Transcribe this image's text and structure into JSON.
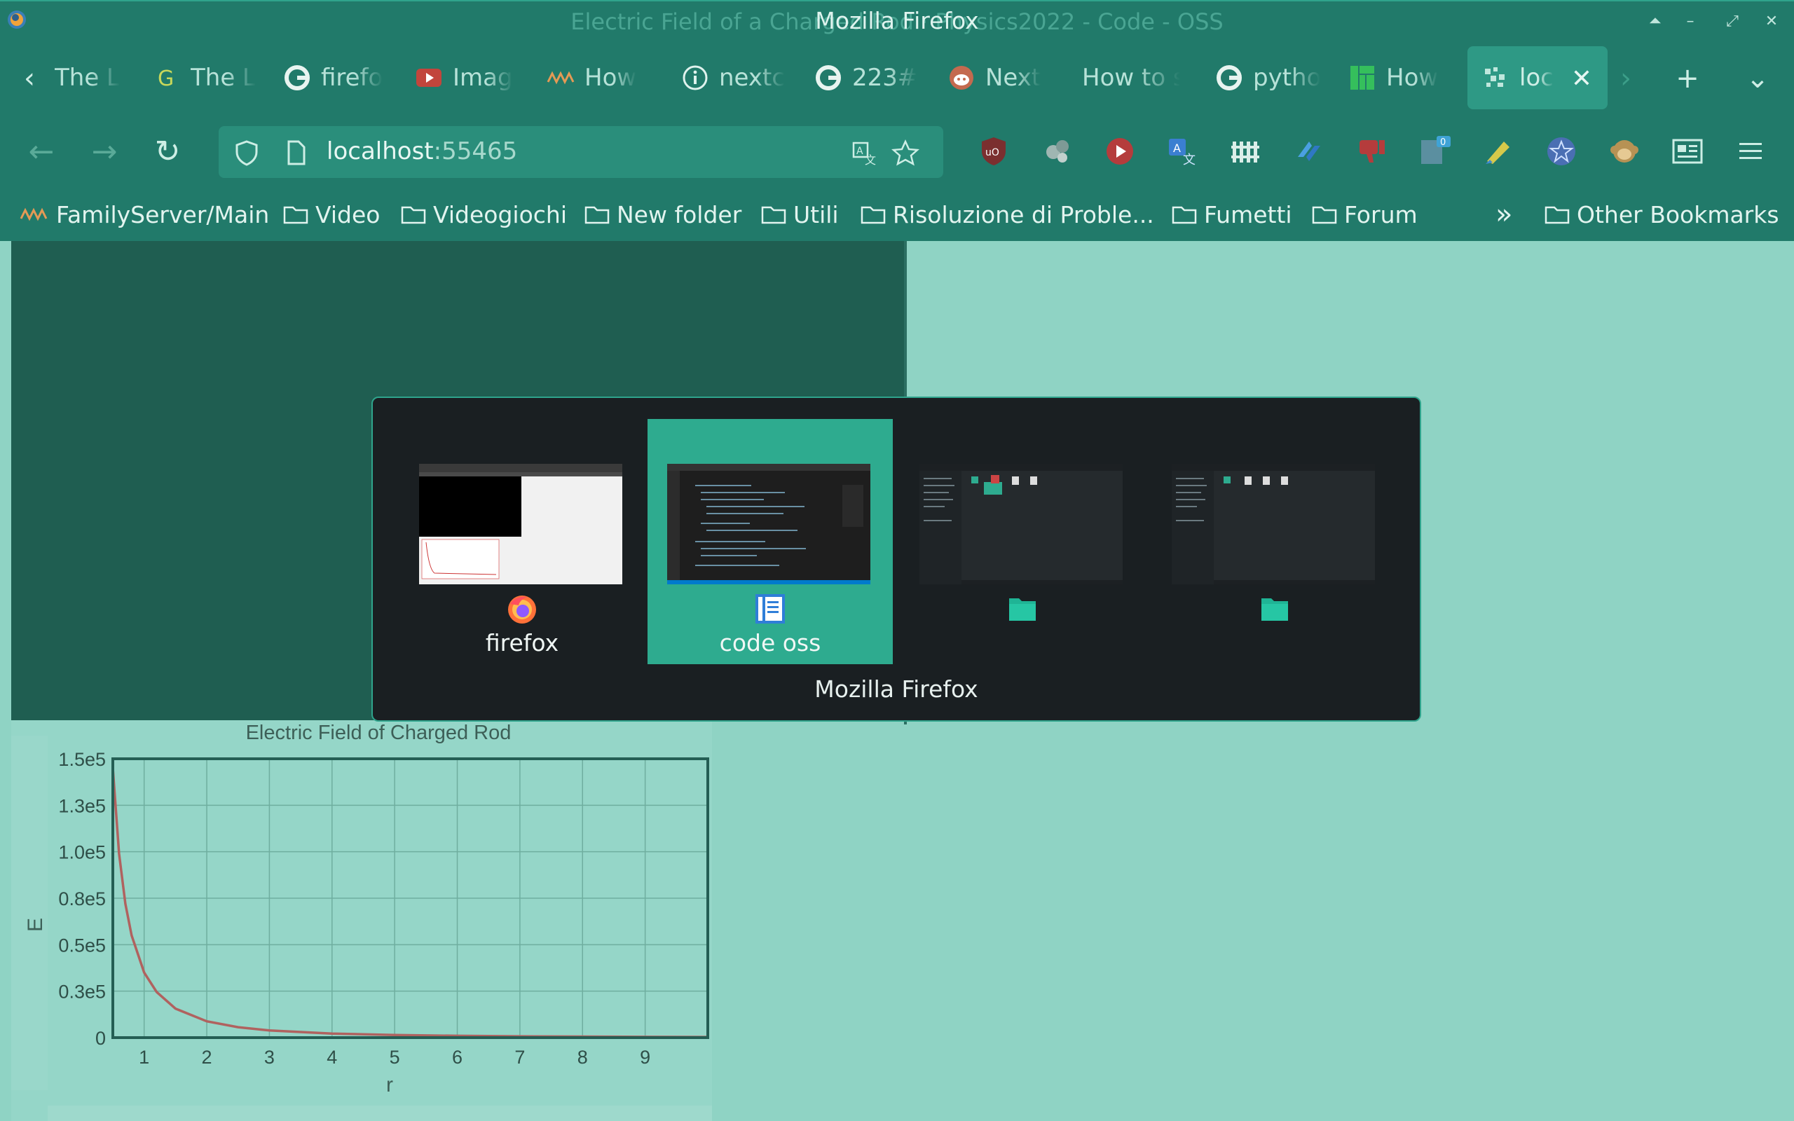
{
  "window": {
    "title_ghost": "Electric Field of a Charged Rod · Physics2022 - Code - OSS",
    "title": "Mozilla Firefox"
  },
  "tabs": [
    {
      "label": "The L",
      "icon": "back-icon"
    },
    {
      "label": "The L",
      "icon": "g-icon"
    },
    {
      "label": "firefo",
      "icon": "google-icon"
    },
    {
      "label": "Imag",
      "icon": "youtube-icon"
    },
    {
      "label": "How",
      "icon": "nextcloud-icon"
    },
    {
      "label": "nextc",
      "icon": "info-icon"
    },
    {
      "label": "223#",
      "icon": "google-icon"
    },
    {
      "label": "Next",
      "icon": "reddit-icon"
    },
    {
      "label": "How to s",
      "icon": ""
    },
    {
      "label": "pytho",
      "icon": "google-icon"
    },
    {
      "label": "How",
      "icon": "manjaro-icon"
    },
    {
      "label": "loc",
      "icon": "puzzle-icon",
      "active": true
    }
  ],
  "urlbar": {
    "host": "localhost",
    "port": ":55465"
  },
  "extensions": {
    "badge_count": "0"
  },
  "bookmarks": {
    "items": [
      "FamilyServer/Main",
      "Video",
      "Videogiochi",
      "New folder",
      "Utili",
      "Risoluzione di Proble...",
      "Fumetti",
      "Forum"
    ],
    "other": "Other Bookmarks"
  },
  "switcher": {
    "items": [
      {
        "label": "firefox",
        "icon": "firefox-icon"
      },
      {
        "label": "code oss",
        "icon": "code-oss-icon",
        "selected": true
      },
      {
        "label": "",
        "icon": "folder-icon"
      },
      {
        "label": "",
        "icon": "folder-icon"
      }
    ],
    "caption": "Mozilla Firefox"
  },
  "colors": {
    "accent": "#2eab8f",
    "chrome": "#217a6a",
    "page_bg": "#8fd3c4",
    "curve": "#b0625f"
  },
  "chart_data": {
    "type": "line",
    "title": "Electric Field of Charged Rod",
    "xlabel": "r",
    "ylabel": "E",
    "xlim": [
      0.5,
      10
    ],
    "ylim": [
      0,
      150000
    ],
    "xticks": [
      "1",
      "2",
      "3",
      "4",
      "5",
      "6",
      "7",
      "8",
      "9"
    ],
    "yticks": [
      "0",
      "0.3e5",
      "0.5e5",
      "0.8e5",
      "1.0e5",
      "1.3e5",
      "1.5e5"
    ],
    "grid": true,
    "series": [
      {
        "x": [
          0.5,
          0.6,
          0.7,
          0.8,
          1.0,
          1.2,
          1.5,
          2.0,
          2.5,
          3.0,
          4.0,
          5.0,
          6.0,
          7.0,
          8.0,
          9.0,
          10.0
        ],
        "y": [
          145000,
          99000,
          72000,
          55000,
          35000,
          24500,
          15600,
          8800,
          5600,
          3900,
          2200,
          1400,
          980,
          720,
          550,
          430,
          350
        ]
      }
    ]
  }
}
